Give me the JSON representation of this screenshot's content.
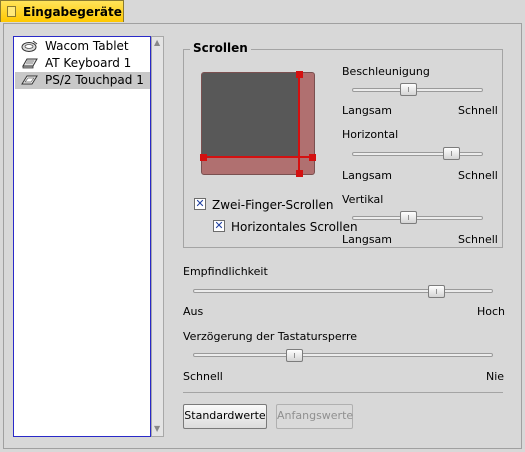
{
  "tab": {
    "label": "Eingabegeräte"
  },
  "devices": [
    {
      "label": "Wacom Tablet",
      "icon": "tablet-icon",
      "selected": false
    },
    {
      "label": "AT Keyboard 1",
      "icon": "keyboard-icon",
      "selected": false
    },
    {
      "label": "PS/2 Touchpad 1",
      "icon": "touchpad-icon",
      "selected": true
    }
  ],
  "scrolling": {
    "title": "Scrollen",
    "two_finger_label": "Zwei-Finger-Scrollen",
    "two_finger_checked": true,
    "horizontal_label": "Horizontales Scrollen",
    "horizontal_checked": true,
    "acceleration": {
      "label": "Beschleunigung",
      "min": "Langsam",
      "max": "Schnell",
      "value": 0.42
    },
    "horizontal": {
      "label": "Horizontal",
      "min": "Langsam",
      "max": "Schnell",
      "value": 0.8
    },
    "vertical": {
      "label": "Vertikal",
      "min": "Langsam",
      "max": "Schnell",
      "value": 0.42
    }
  },
  "sensitivity": {
    "label": "Empfindlichkeit",
    "min": "Aus",
    "max": "Hoch",
    "value": 0.83
  },
  "delay": {
    "label": "Verzögerung der Tastatursperre",
    "min": "Schnell",
    "max": "Nie",
    "value": 0.33
  },
  "buttons": {
    "defaults": "Standardwerte",
    "revert": "Anfangswerte",
    "revert_enabled": false
  },
  "colors": {
    "tab": "#ffc800",
    "pad_area": "#585858",
    "pad_edge": "#b07070",
    "scroll_marker": "#d41010",
    "list_border": "#2a2ac8"
  }
}
